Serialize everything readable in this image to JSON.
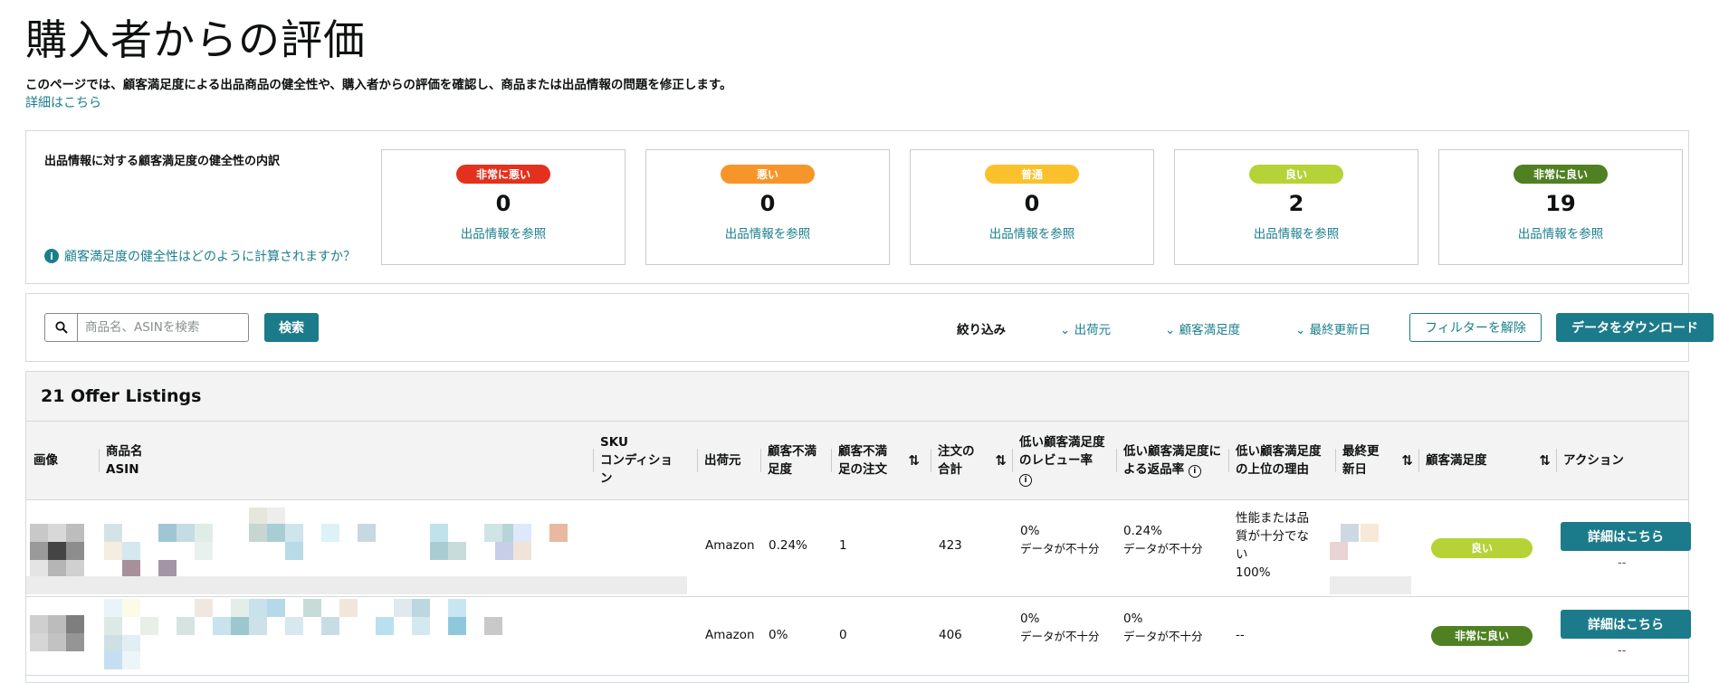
{
  "page": {
    "title": "購入者からの評価",
    "description": "このページでは、顧客満足度による出品商品の健全性や、購入者からの評価を確認し、商品または出品情報の問題を修正します。",
    "learn_more": "詳細はこちら"
  },
  "breakdown": {
    "label": "出品情報に対する顧客満足度の健全性の内訳",
    "help_link": "顧客満足度の健全性はどのように計算されますか？",
    "cards": [
      {
        "badge": "非常に悪い",
        "count": "0",
        "link": "出品情報を参照",
        "color": "#e3311e"
      },
      {
        "badge": "悪い",
        "count": "0",
        "link": "出品情報を参照",
        "color": "#f7952a"
      },
      {
        "badge": "普通",
        "count": "0",
        "link": "出品情報を参照",
        "color": "#fbc12d"
      },
      {
        "badge": "良い",
        "count": "2",
        "link": "出品情報を参照",
        "color": "#b5d336"
      },
      {
        "badge": "非常に良い",
        "count": "19",
        "link": "出品情報を参照",
        "color": "#4f8022"
      }
    ]
  },
  "filters": {
    "search_placeholder": "商品名、ASINを検索",
    "search_button": "検索",
    "filter_label": "絞り込み",
    "dropdowns": [
      "出荷元",
      "顧客満足度",
      "最終更新日"
    ],
    "clear_button": "フィルターを解除",
    "download_button": "データをダウンロード"
  },
  "table": {
    "title": "21 Offer Listings",
    "headers": {
      "image": "画像",
      "product_name": "商品名",
      "asin": "ASIN",
      "sku": "SKU",
      "condition": "コンディション",
      "ship_from": "出荷元",
      "dissat_rate_1": "顧客不満",
      "dissat_rate_2": "足度",
      "dissat_orders_1": "顧客不満",
      "dissat_orders_2": "足の注文",
      "total_orders_1": "注文の",
      "total_orders_2": "合計",
      "low_review_1": "低い顧客満足度",
      "low_review_2": "のレビュー率",
      "return_rate_1": "低い顧客満足度に",
      "return_rate_2": "よる返品率",
      "top_reason_1": "低い顧客満足度",
      "top_reason_2": "の上位の理由",
      "last_updated_1": "最終更",
      "last_updated_2": "新日",
      "satisfaction": "顧客満足度",
      "action": "アクション"
    },
    "rows": [
      {
        "ship_from": "Amazon",
        "dissat_rate": "0.24%",
        "dissat_orders": "1",
        "total_orders": "423",
        "low_review_rate": "0%",
        "low_review_note": "データが不十分",
        "return_rate": "0.24%",
        "return_note": "データが不十分",
        "reason_1": "性能または品",
        "reason_2": "質が十分でな",
        "reason_3": "い",
        "reason_4": "100%",
        "satisfaction": "良い",
        "satisfaction_color": "#b5d336",
        "action_button": "詳細はこちら",
        "action_sub": "--"
      },
      {
        "ship_from": "Amazon",
        "dissat_rate": "0%",
        "dissat_orders": "0",
        "total_orders": "406",
        "low_review_rate": "0%",
        "low_review_note": "データが不十分",
        "return_rate": "0%",
        "return_note": "データが不十分",
        "reason_1": "--",
        "satisfaction": "非常に良い",
        "satisfaction_color": "#4f8022",
        "action_button": "詳細はこちら",
        "action_sub": "--"
      }
    ]
  },
  "colors": {
    "accent_teal": "#1c7b8a",
    "link": "#1a7f8c"
  }
}
